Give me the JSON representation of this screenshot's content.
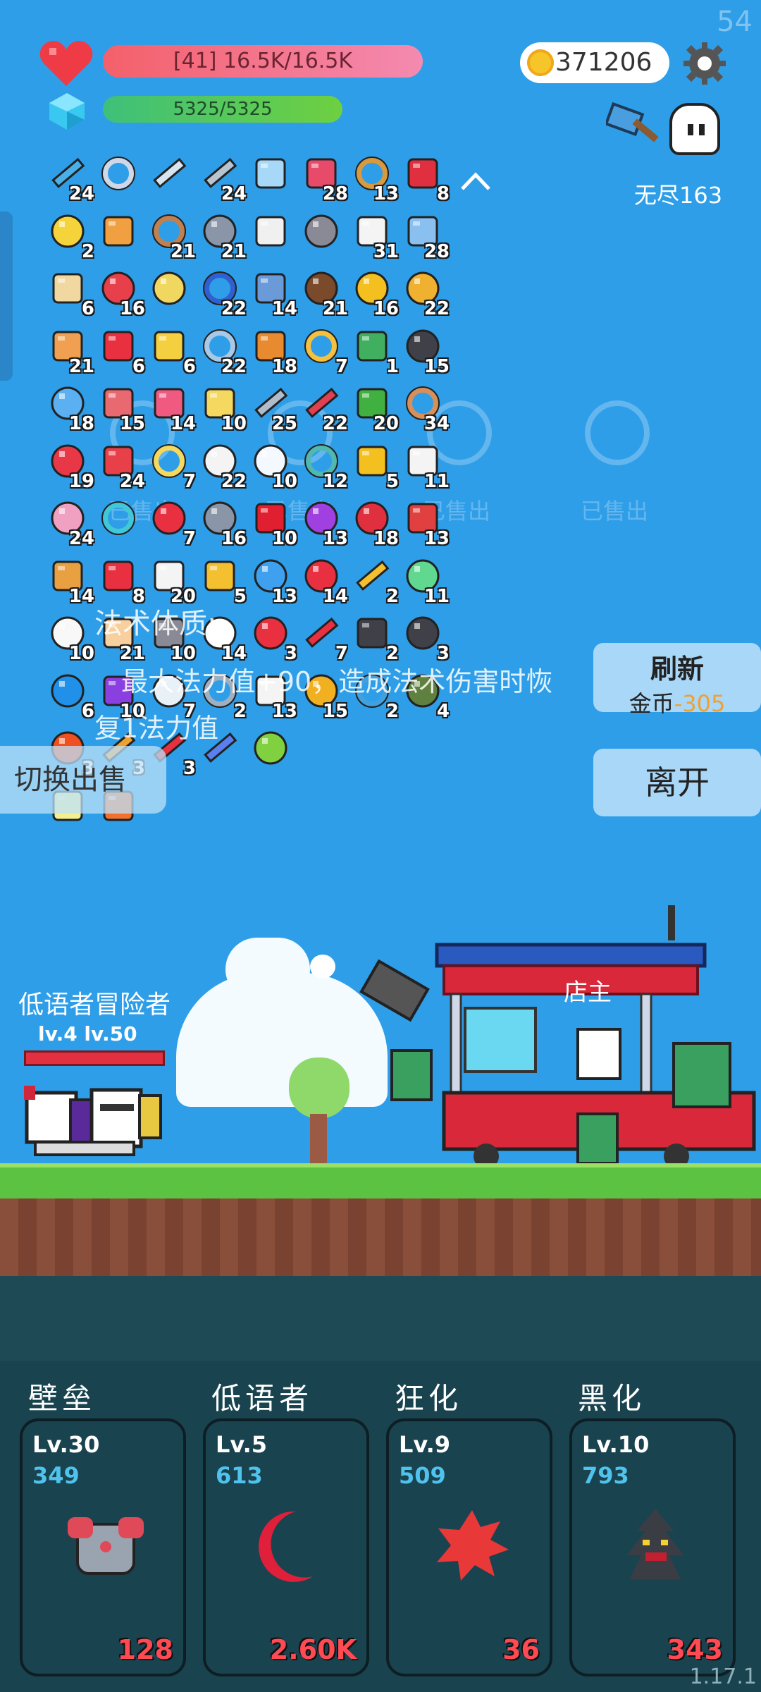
{
  "hud": {
    "fps": "54",
    "hp_text": "[41] 16.5K/16.5K",
    "mp_text": "5325/5325",
    "coins": "371206",
    "endless_label": "无尽163"
  },
  "inventory": {
    "rows": [
      [
        {
          "icon": "wand-icon",
          "count": "24"
        },
        {
          "icon": "hook-icon",
          "count": ""
        },
        {
          "icon": "sword-icon",
          "count": ""
        },
        {
          "icon": "dagger-icon",
          "count": "24"
        },
        {
          "icon": "empty-slot-icon",
          "count": ""
        },
        {
          "icon": "jam-jar-icon",
          "count": "28"
        },
        {
          "icon": "bow-icon",
          "count": "13"
        },
        {
          "icon": "shield-red-icon",
          "count": "8"
        }
      ],
      [
        {
          "icon": "lemon-drop-icon",
          "count": "2"
        },
        {
          "icon": "treasure-map-icon",
          "count": ""
        },
        {
          "icon": "fishhook-icon",
          "count": "21"
        },
        {
          "icon": "mace-icon",
          "count": "21"
        },
        {
          "icon": "book-icon",
          "count": ""
        },
        {
          "icon": "viking-helmet-icon",
          "count": ""
        },
        {
          "icon": "dice-icon",
          "count": "31"
        },
        {
          "icon": "shirt-icon",
          "count": "28"
        }
      ],
      [
        {
          "icon": "map-icon",
          "count": "6"
        },
        {
          "icon": "heart-icon",
          "count": "16"
        },
        {
          "icon": "moon-cookie-icon",
          "count": ""
        },
        {
          "icon": "target-icon",
          "count": "22"
        },
        {
          "icon": "shield-blue-icon",
          "count": "14"
        },
        {
          "icon": "coconut-icon",
          "count": "21"
        },
        {
          "icon": "sunflower-icon",
          "count": "16"
        },
        {
          "icon": "pineapple-icon",
          "count": "22"
        }
      ],
      [
        {
          "icon": "scroll-icon",
          "count": "21"
        },
        {
          "icon": "percent-card-icon",
          "count": "6"
        },
        {
          "icon": "cheese-icon",
          "count": "6"
        },
        {
          "icon": "molecule-icon",
          "count": "22"
        },
        {
          "icon": "briefcase-icon",
          "count": "18"
        },
        {
          "icon": "ring-icon",
          "count": "7"
        },
        {
          "icon": "money-icon",
          "count": "1"
        },
        {
          "icon": "bomb-pot-icon",
          "count": "15"
        }
      ],
      [
        {
          "icon": "cat-bowl-icon",
          "count": "18"
        },
        {
          "icon": "steak-icon",
          "count": "15"
        },
        {
          "icon": "potion-icon",
          "count": "14"
        },
        {
          "icon": "note-icon",
          "count": "10"
        },
        {
          "icon": "greatsword-icon",
          "count": "25"
        },
        {
          "icon": "flask-icon",
          "count": "22"
        },
        {
          "icon": "flag-icon",
          "count": "20"
        },
        {
          "icon": "donut-icon",
          "count": "34"
        }
      ],
      [
        {
          "icon": "strawberry-icon",
          "count": "19"
        },
        {
          "icon": "watermelon-icon",
          "count": "24"
        },
        {
          "icon": "halo-icon",
          "count": "7"
        },
        {
          "icon": "flower-icon",
          "count": "22"
        },
        {
          "icon": "cloud-icon",
          "count": "10"
        },
        {
          "icon": "eye-disc-icon",
          "count": "12"
        },
        {
          "icon": "medkit-icon",
          "count": "5"
        },
        {
          "icon": "clipboard-icon",
          "count": "11"
        }
      ],
      [
        {
          "icon": "ice-cream-icon",
          "count": "24"
        },
        {
          "icon": "spiral-icon",
          "count": ""
        },
        {
          "icon": "location-pin-icon",
          "count": "7"
        },
        {
          "icon": "elephant-icon",
          "count": "16"
        },
        {
          "icon": "red-card-icon",
          "count": "10"
        },
        {
          "icon": "orb-icon",
          "count": "13"
        },
        {
          "icon": "apple-icon",
          "count": "18"
        },
        {
          "icon": "sock-icon",
          "count": "13"
        }
      ],
      [
        {
          "icon": "book-castle-icon",
          "count": "14"
        },
        {
          "icon": "gift-icon",
          "count": "8"
        },
        {
          "icon": "playing-card-icon",
          "count": "20"
        },
        {
          "icon": "beer-icon",
          "count": "5"
        },
        {
          "icon": "chat-bubble-icon",
          "count": "13"
        },
        {
          "icon": "mushroom-icon",
          "count": "14"
        },
        {
          "icon": "magic-wand-icon",
          "count": "2"
        },
        {
          "icon": "slime-icon",
          "count": "11"
        }
      ],
      [
        {
          "icon": "egg-icon",
          "count": "10"
        },
        {
          "icon": "hand-icon",
          "count": "21"
        },
        {
          "icon": "tombstone-icon",
          "count": "10"
        },
        {
          "icon": "ghost-icon",
          "count": "14"
        },
        {
          "icon": "broken-heart-icon",
          "count": "3"
        },
        {
          "icon": "heat-waves-icon",
          "count": "7"
        },
        {
          "icon": "skull-book-icon",
          "count": "2"
        },
        {
          "icon": "bat-icon",
          "count": "3"
        }
      ],
      [
        {
          "icon": "blue-gem-icon",
          "count": "6"
        },
        {
          "icon": "purple-box-icon",
          "count": "10"
        },
        {
          "icon": "lightbulb-icon",
          "count": "7"
        },
        {
          "icon": "compass-icon",
          "count": "2"
        },
        {
          "icon": "envelope-icon",
          "count": "13"
        },
        {
          "icon": "pineapple-gold-icon",
          "count": "15"
        },
        {
          "icon": "crosshair-icon",
          "count": "2"
        },
        {
          "icon": "grenade-icon",
          "count": "4"
        }
      ],
      [
        {
          "icon": "fire-face-icon",
          "count": "3"
        },
        {
          "icon": "comet-icon",
          "count": "3"
        },
        {
          "icon": "pill-red-icon",
          "count": "3"
        },
        {
          "icon": "pill-blue-icon",
          "count": ""
        },
        {
          "icon": "lime-icon",
          "count": ""
        }
      ],
      [
        {
          "icon": "light-rune-icon",
          "count": ""
        },
        {
          "icon": "fire-rune-icon",
          "count": ""
        }
      ]
    ]
  },
  "shop": {
    "sold_label": "已售出",
    "tooltip_title": "法术体质:",
    "tooltip_body": "最大法力值+90，造成法术伤害时恢",
    "tooltip_body2": "复1法力值",
    "refresh_label": "刷新",
    "refresh_cost_label": "金币",
    "refresh_cost": "-305",
    "leave_label": "离开",
    "switch_label": "切换出售",
    "shopkeeper_label": "店主"
  },
  "party": {
    "names": "低语者冒险者",
    "levels": "lv.4  lv.50"
  },
  "skills": [
    {
      "title": "壁垒",
      "level": "Lv.30",
      "value": "349",
      "cost": "128",
      "icon": "armor-icon"
    },
    {
      "title": "低语者",
      "level": "Lv.5",
      "value": "613",
      "cost": "2.60K",
      "icon": "crescent-moon-icon"
    },
    {
      "title": "狂化",
      "level": "Lv.9",
      "value": "509",
      "cost": "36",
      "icon": "blood-splat-icon"
    },
    {
      "title": "黑化",
      "level": "Lv.10",
      "value": "793",
      "cost": "343",
      "icon": "dark-tree-icon"
    }
  ],
  "version": "1.17.1",
  "colors": {
    "sky": "#2f9ee8",
    "hp_bar": "#f4606a",
    "mp_bar": "#3ec07a",
    "cost_red": "#ff4a54",
    "skill_value": "#4fc3ee"
  }
}
